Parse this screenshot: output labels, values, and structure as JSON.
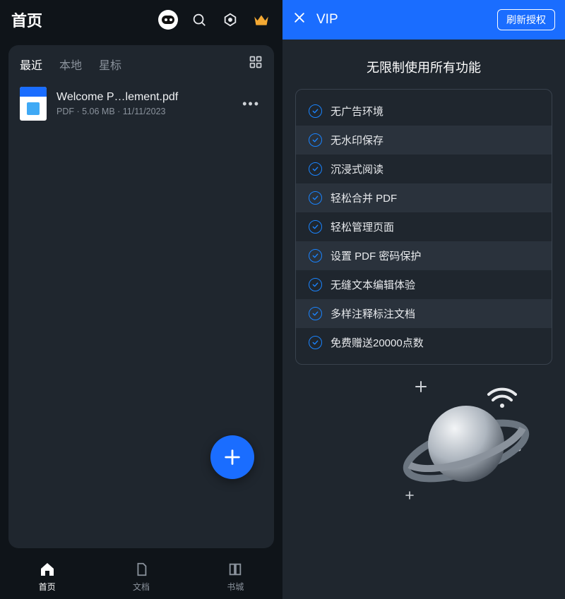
{
  "left": {
    "title": "首页",
    "tabs": [
      "最近",
      "本地",
      "星标"
    ],
    "activeTab": 0,
    "file": {
      "name": "Welcome P…lement.pdf",
      "type": "PDF",
      "size": "5.06 MB",
      "date": "11/11/2023"
    },
    "nav": [
      {
        "label": "首页"
      },
      {
        "label": "文档"
      },
      {
        "label": "书城"
      }
    ],
    "activeNav": 0
  },
  "right": {
    "title": "VIP",
    "refreshLabel": "刷新授权",
    "headline": "无限制使用所有功能",
    "features": [
      "无广告环境",
      "无水印保存",
      "沉浸式阅读",
      "轻松合并 PDF",
      "轻松管理页面",
      "设置 PDF 密码保护",
      "无缝文本编辑体验",
      "多样注释标注文档",
      "免费赠送20000点数"
    ]
  }
}
